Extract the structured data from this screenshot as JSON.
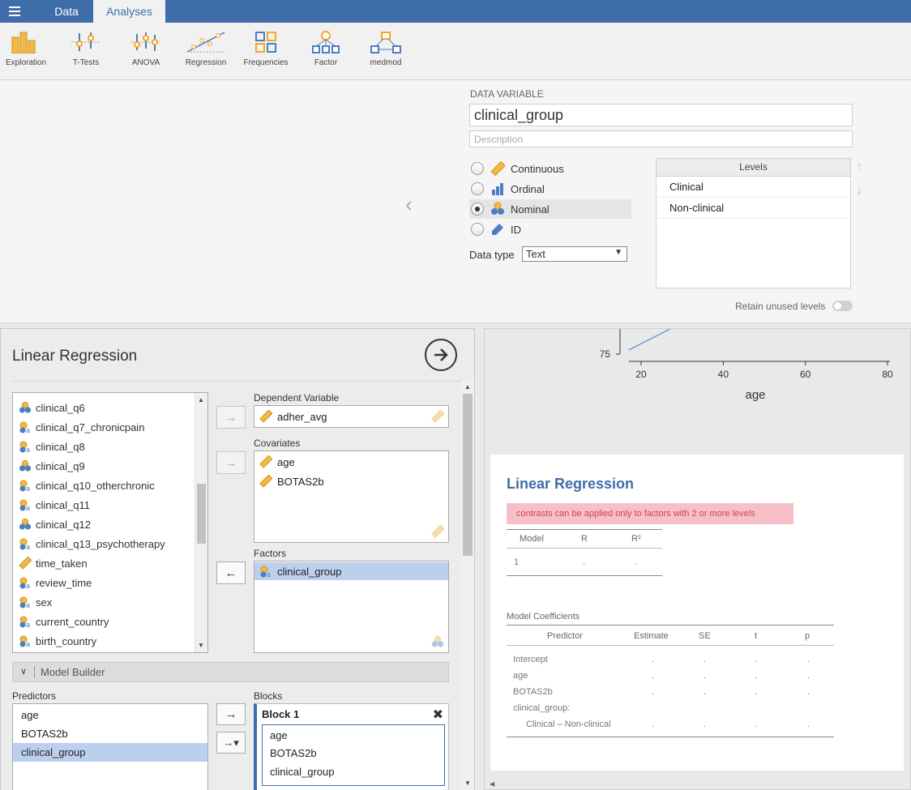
{
  "nav": {
    "data_tab": "Data",
    "analyses_tab": "Analyses"
  },
  "ribbon": [
    {
      "label": "Exploration",
      "icon": "exploration-icon"
    },
    {
      "label": "T-Tests",
      "icon": "ttests-icon"
    },
    {
      "label": "ANOVA",
      "icon": "anova-icon"
    },
    {
      "label": "Regression",
      "icon": "regression-icon"
    },
    {
      "label": "Frequencies",
      "icon": "frequencies-icon"
    },
    {
      "label": "Factor",
      "icon": "factor-icon"
    },
    {
      "label": "medmod",
      "icon": "medmod-icon"
    }
  ],
  "data_variable": {
    "section_title": "DATA VARIABLE",
    "name": "clinical_group",
    "description_placeholder": "Description",
    "measure_types": [
      {
        "label": "Continuous",
        "selected": false
      },
      {
        "label": "Ordinal",
        "selected": false
      },
      {
        "label": "Nominal",
        "selected": true
      },
      {
        "label": "ID",
        "selected": false
      }
    ],
    "data_type_label": "Data type",
    "data_type_value": "Text",
    "levels_header": "Levels",
    "levels": [
      "Clinical",
      "Non-clinical"
    ],
    "retain_label": "Retain unused levels"
  },
  "analysis": {
    "title": "Linear Regression",
    "variables": [
      {
        "name": "clinical_q6",
        "type": "nominal"
      },
      {
        "name": "clinical_q7_chronicpain",
        "type": "nominal-text"
      },
      {
        "name": "clinical_q8",
        "type": "nominal-text"
      },
      {
        "name": "clinical_q9",
        "type": "nominal"
      },
      {
        "name": "clinical_q10_otherchronic",
        "type": "nominal-text"
      },
      {
        "name": "clinical_q11",
        "type": "nominal-text"
      },
      {
        "name": "clinical_q12",
        "type": "nominal"
      },
      {
        "name": "clinical_q13_psychotherapy",
        "type": "nominal-text"
      },
      {
        "name": "time_taken",
        "type": "continuous"
      },
      {
        "name": "review_time",
        "type": "nominal-text"
      },
      {
        "name": "sex",
        "type": "nominal-text"
      },
      {
        "name": "current_country",
        "type": "nominal-text"
      },
      {
        "name": "birth_country",
        "type": "nominal-text"
      }
    ],
    "dependent_label": "Dependent Variable",
    "dependent": "adher_avg",
    "covariates_label": "Covariates",
    "covariates": [
      "age",
      "BOTAS2b"
    ],
    "factors_label": "Factors",
    "factors": [
      "clinical_group"
    ],
    "model_builder_label": "Model Builder",
    "predictors_label": "Predictors",
    "predictors": [
      "age",
      "BOTAS2b",
      "clinical_group"
    ],
    "blocks_label": "Blocks",
    "block_title": "Block 1",
    "block_items": [
      "age",
      "BOTAS2b",
      "clinical_group"
    ]
  },
  "chart_data": {
    "type": "scatter",
    "x_ticks": [
      "20",
      "40",
      "60",
      "80"
    ],
    "y_tick": "75",
    "xlabel": "age",
    "xlim": [
      17,
      80
    ]
  },
  "results": {
    "title": "Linear Regression",
    "error": "contrasts can be applied only to factors with 2 or more levels",
    "fit_headers": [
      "Model",
      "R",
      "R²"
    ],
    "fit_row": [
      "1",
      ".",
      "."
    ],
    "coef_title": "Model Coefficients",
    "coef_headers": [
      "Predictor",
      "Estimate",
      "SE",
      "t",
      "p"
    ],
    "coef_rows": [
      "Intercept",
      "age",
      "BOTAS2b",
      "clinical_group:"
    ],
    "coef_subrow": "Clinical – Non-clinical",
    "dot": "."
  },
  "colors": {
    "topbar": "#3e6da9",
    "accent": "#3e6da9",
    "selection": "#bcd0ee",
    "error_bg": "#f7bfc8",
    "error_text": "#d0405a"
  }
}
